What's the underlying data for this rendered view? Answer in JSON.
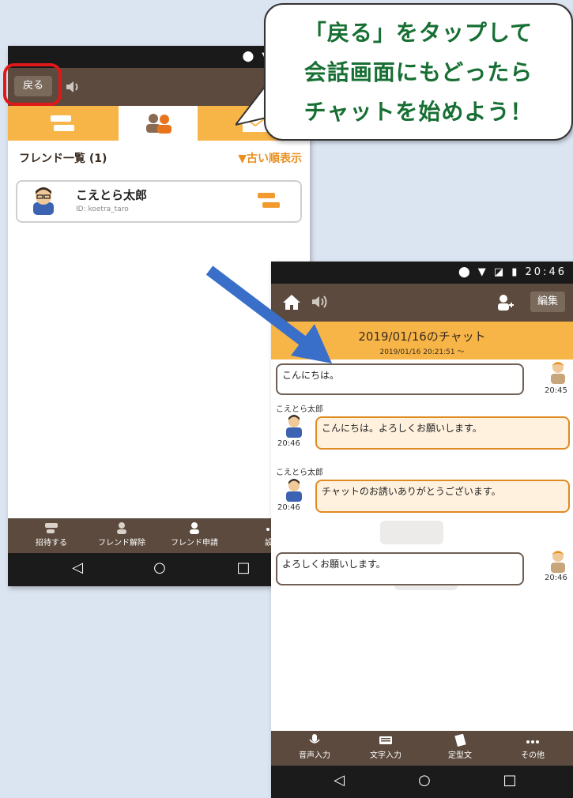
{
  "callout": {
    "line1": "「戻る」をタップして",
    "line2": "会話画面にもどったら",
    "line3": "チャットを始めよう！"
  },
  "phone1": {
    "back_label": "戻る",
    "friends_header": "フレンド一覧 (1)",
    "sort_label": "▼古い順表示",
    "friend": {
      "name": "こえとら太郎",
      "id": "ID: koetra_taro"
    },
    "bottom_actions": [
      "招待する",
      "フレンド解除",
      "フレンド申請",
      "設定"
    ]
  },
  "phone2": {
    "status_time": "20:46",
    "edit_label": "編集",
    "chat_title": "2019/01/16のチャット",
    "chat_subtitle": "2019/01/16 20:21:51 〜",
    "messages": [
      {
        "side": "right",
        "text": "こんにちは。",
        "time": "20:45",
        "sender": ""
      },
      {
        "side": "left",
        "text": "こんにちは。よろしくお願いします。",
        "time": "20:46",
        "sender": "こえとら太郎"
      },
      {
        "side": "left",
        "text": "チャットのお誘いありがとうございます。",
        "time": "20:46",
        "sender": "こえとら太郎"
      },
      {
        "side": "right",
        "text": "よろしくお願いします。",
        "time": "20:46",
        "sender": ""
      }
    ],
    "bottom_actions": [
      "音声入力",
      "文字入力",
      "定型文",
      "その他"
    ]
  },
  "colors": {
    "appbar": "#5b4a3d",
    "accent_orange": "#f7b547",
    "bubble_orange_border": "#e08a22",
    "callout_text": "#176f33",
    "highlight_red": "#e01818",
    "arrow_blue": "#3a6fc9",
    "background": "#dbe4f1"
  }
}
